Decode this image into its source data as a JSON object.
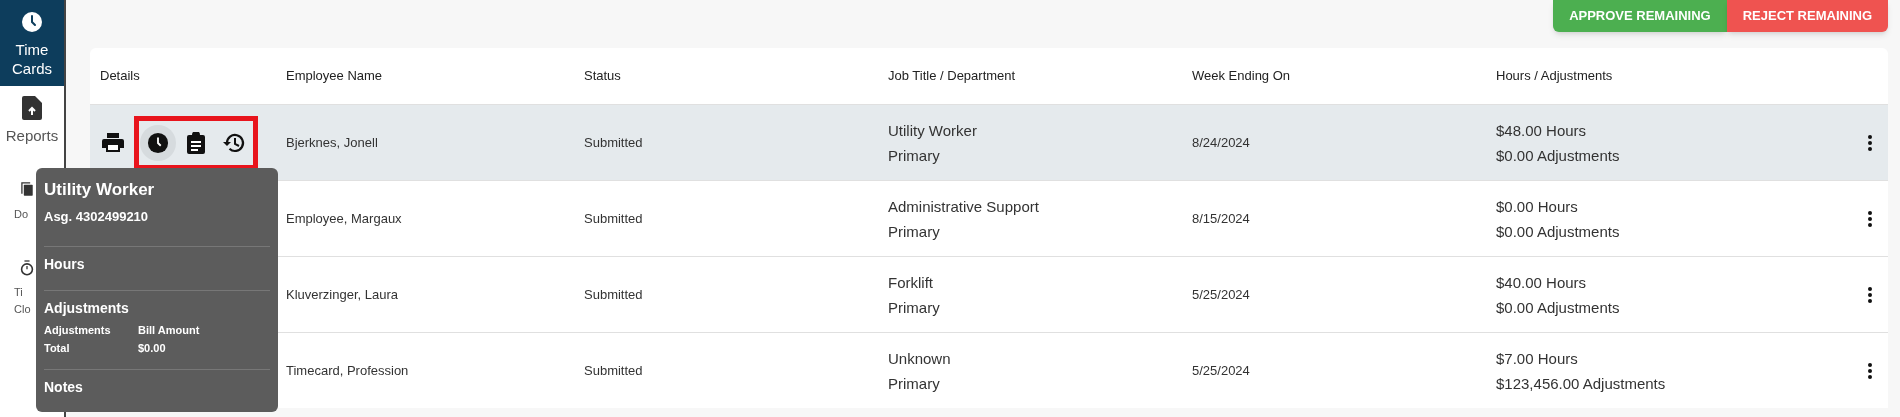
{
  "sidebar": {
    "items": [
      {
        "lines": [
          "Time",
          "Cards"
        ],
        "selected": true,
        "covered": false
      },
      {
        "lines": [
          "Reports"
        ],
        "selected": false,
        "covered": false
      },
      {
        "lines": [
          "Do"
        ],
        "selected": false,
        "covered": true
      },
      {
        "lines": [
          "Ti",
          "Clo"
        ],
        "selected": false,
        "covered": true
      }
    ]
  },
  "actions": [
    {
      "label": "APPROVE REMAINING",
      "kind": "approve"
    },
    {
      "label": "REJECT REMAINING",
      "kind": "reject"
    }
  ],
  "table": {
    "columns": [
      "Details",
      "Employee Name",
      "Status",
      "Job Title / Department",
      "Week Ending On",
      "Hours / Adjustments"
    ],
    "rows": [
      {
        "selected": true,
        "employee": "Bjerknes, Jonell",
        "status": "Submitted",
        "job": "Utility Worker",
        "department": "Primary",
        "week": "8/24/2024",
        "hours": "$48.00 Hours",
        "adjustments": "$0.00 Adjustments"
      },
      {
        "selected": false,
        "employee": "Employee, Margaux",
        "status": "Submitted",
        "job": "Administrative Support",
        "department": "Primary",
        "week": "8/15/2024",
        "hours": "$0.00 Hours",
        "adjustments": "$0.00 Adjustments"
      },
      {
        "selected": false,
        "employee": "Kluverzinger, Laura",
        "status": "Submitted",
        "job": "Forklift",
        "department": "Primary",
        "week": "5/25/2024",
        "hours": "$40.00 Hours",
        "adjustments": "$0.00 Adjustments"
      },
      {
        "selected": false,
        "employee": "Timecard, Profession",
        "status": "Submitted",
        "job": "Unknown",
        "department": "Primary",
        "week": "5/25/2024",
        "hours": "$7.00 Hours",
        "adjustments": "$123,456.00 Adjustments"
      }
    ]
  },
  "tooltip": {
    "title": "Utility Worker",
    "assignment": "Asg. 4302499210",
    "sections": [
      {
        "heading": "Hours"
      },
      {
        "heading": "Adjustments",
        "table": [
          [
            "Adjustments",
            "Bill Amount"
          ],
          [
            "Total",
            "$0.00"
          ]
        ]
      },
      {
        "heading": "Notes"
      }
    ]
  }
}
